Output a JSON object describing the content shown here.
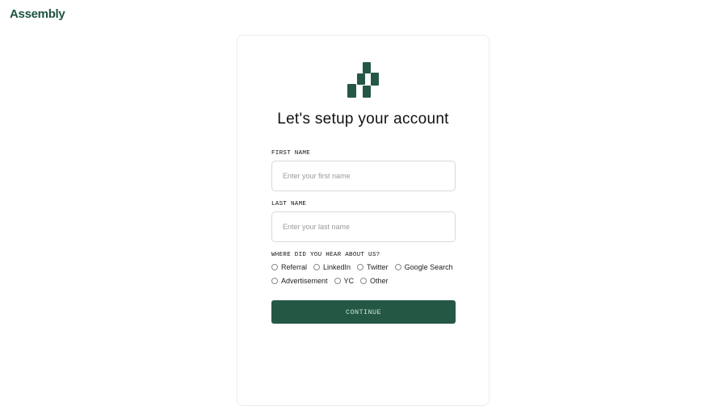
{
  "header": {
    "brand": "Assembly"
  },
  "form": {
    "title": "Let's setup your account",
    "first_name": {
      "label": "FIRST NAME",
      "placeholder": "Enter your first name",
      "value": ""
    },
    "last_name": {
      "label": "LAST NAME",
      "placeholder": "Enter your last name",
      "value": ""
    },
    "source": {
      "label": "WHERE DID YOU HEAR ABOUT US?",
      "options": [
        "Referral",
        "LinkedIn",
        "Twitter",
        "Google Search",
        "Advertisement",
        "YC",
        "Other"
      ],
      "selected": null
    },
    "continue_label": "CONTINUE"
  },
  "colors": {
    "brand": "#1d5441",
    "button": "#245845",
    "button_text": "#cfe3d6"
  },
  "icons": {
    "logo": "assembly-logo-icon"
  }
}
